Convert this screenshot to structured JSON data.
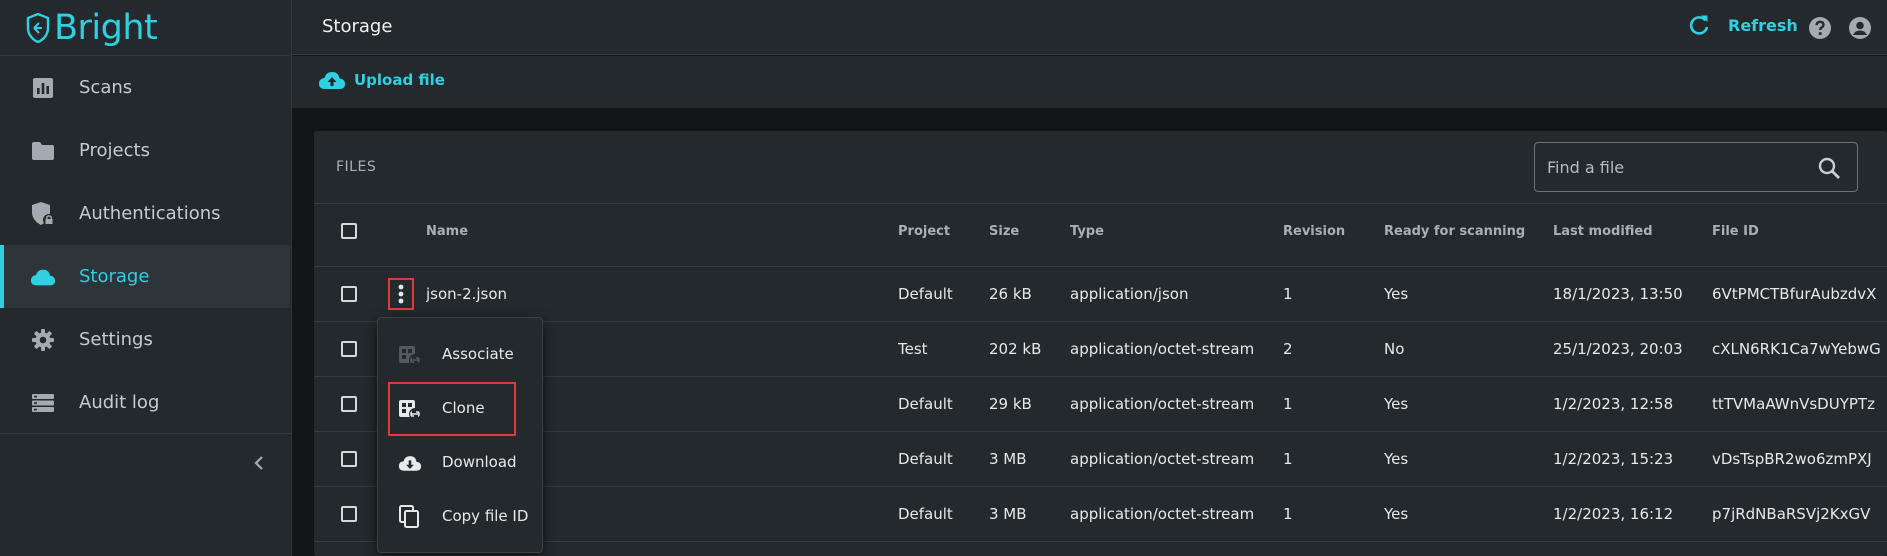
{
  "app": {
    "brand": "Bright"
  },
  "sidebar": {
    "items": [
      {
        "label": "Scans",
        "icon": "chart-icon"
      },
      {
        "label": "Projects",
        "icon": "folder-icon"
      },
      {
        "label": "Authentications",
        "icon": "shield-lock-icon"
      },
      {
        "label": "Storage",
        "icon": "cloud-icon",
        "active": true
      },
      {
        "label": "Settings",
        "icon": "gear-icon"
      },
      {
        "label": "Audit log",
        "icon": "list-icon"
      }
    ],
    "collapse_icon": "chevron-left-icon"
  },
  "header": {
    "title": "Storage",
    "refresh_label": "Refresh"
  },
  "toolbar": {
    "upload_label": "Upload file"
  },
  "files": {
    "title": "FILES",
    "search": {
      "placeholder": "Find a file",
      "value": ""
    },
    "columns": [
      "Name",
      "Project",
      "Size",
      "Type",
      "Revision",
      "Ready for scanning",
      "Last modified",
      "File ID"
    ],
    "rows": [
      {
        "name": "json-2.json",
        "project": "Default",
        "size": "26 kB",
        "type": "application/json",
        "revision": "1",
        "ready": "Yes",
        "modified": "18/1/2023, 13:50",
        "file_id": "6VtPMCTBfurAubzdvX"
      },
      {
        "name": "",
        "project": "Test",
        "size": "202 kB",
        "type": "application/octet-stream",
        "revision": "2",
        "ready": "No",
        "modified": "25/1/2023, 20:03",
        "file_id": "cXLN6RK1Ca7wYebwG"
      },
      {
        "name": "",
        "project": "Default",
        "size": "29 kB",
        "type": "application/octet-stream",
        "revision": "1",
        "ready": "Yes",
        "modified": "1/2/2023, 12:58",
        "file_id": "ttTVMaAWnVsDUYPTz"
      },
      {
        "name": "",
        "project": "Default",
        "size": "3 MB",
        "type": "application/octet-stream",
        "revision": "1",
        "ready": "Yes",
        "modified": "1/2/2023, 15:23",
        "file_id": "vDsTspBR2wo6zmPXJ"
      },
      {
        "name": "",
        "project": "Default",
        "size": "3 MB",
        "type": "application/octet-stream",
        "revision": "1",
        "ready": "Yes",
        "modified": "1/2/2023, 16:12",
        "file_id": "p7jRdNBaRSVj2KxGV"
      }
    ]
  },
  "context_menu": {
    "items": [
      {
        "label": "Associate",
        "icon": "associate-icon"
      },
      {
        "label": "Clone",
        "icon": "clone-icon"
      },
      {
        "label": "Download",
        "icon": "cloud-download-icon"
      },
      {
        "label": "Copy file ID",
        "icon": "copy-icon"
      }
    ]
  },
  "colors": {
    "accent": "#2fd0e1",
    "highlight": "#e23a3a",
    "background": "#121619",
    "panel": "#23292d"
  }
}
